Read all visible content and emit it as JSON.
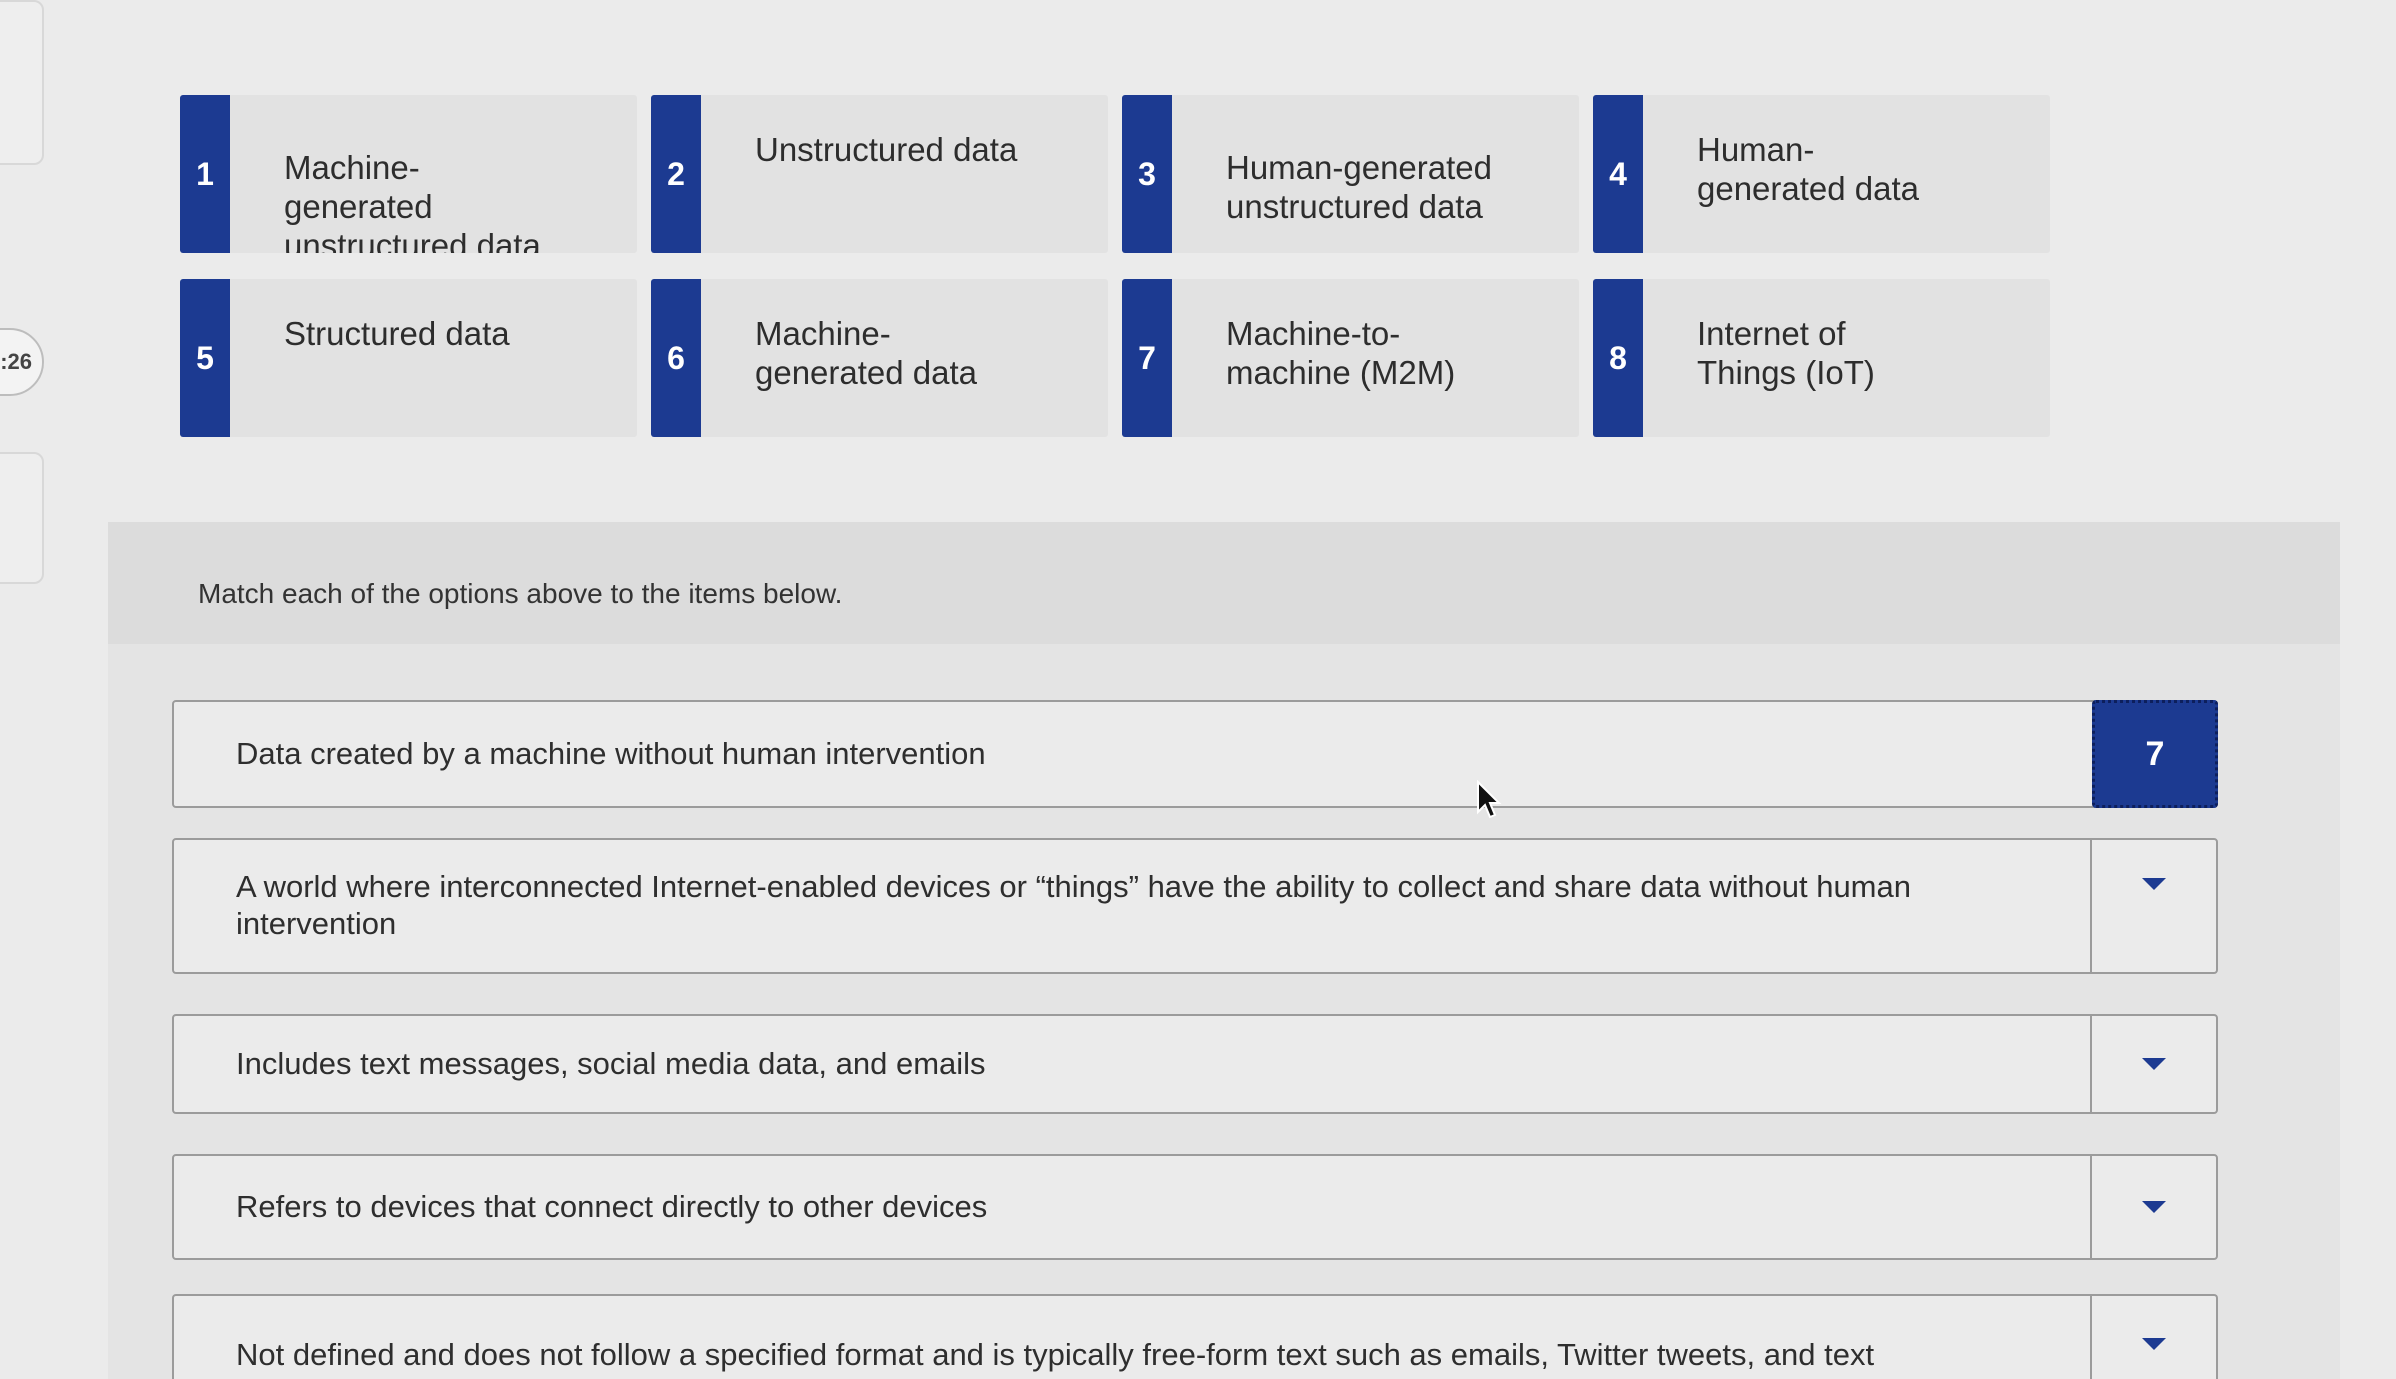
{
  "timer": {
    "text": ":26"
  },
  "options": [
    {
      "number": "1",
      "label": "Machine-generated unstructured data"
    },
    {
      "number": "2",
      "label": "Unstructured data"
    },
    {
      "number": "3",
      "label": "Human-generated unstructured data"
    },
    {
      "number": "4",
      "label": "Human-generated data"
    },
    {
      "number": "5",
      "label": "Structured data"
    },
    {
      "number": "6",
      "label": "Machine-generated data"
    },
    {
      "number": "7",
      "label": "Machine-to-machine (M2M)"
    },
    {
      "number": "8",
      "label": "Internet of Things (IoT)"
    }
  ],
  "instructions": "Match each of the options above to the items below.",
  "items": [
    {
      "text": "Data created by a machine without human intervention",
      "selected": "7"
    },
    {
      "text": "A world where interconnected Internet-enabled devices or “things” have the ability to collect and share data without human intervention",
      "selected": ""
    },
    {
      "text": "Includes text messages, social media data, and emails",
      "selected": ""
    },
    {
      "text": "Refers to devices that connect directly to other devices",
      "selected": ""
    },
    {
      "text": "Not defined and does not follow a specified format and is typically free-form text such as emails, Twitter tweets, and text",
      "selected": ""
    }
  ],
  "icons": {
    "dropdown": "chevron-down-icon",
    "cursor": "mouse-pointer-icon"
  },
  "colors": {
    "accent": "#1c3a91"
  }
}
